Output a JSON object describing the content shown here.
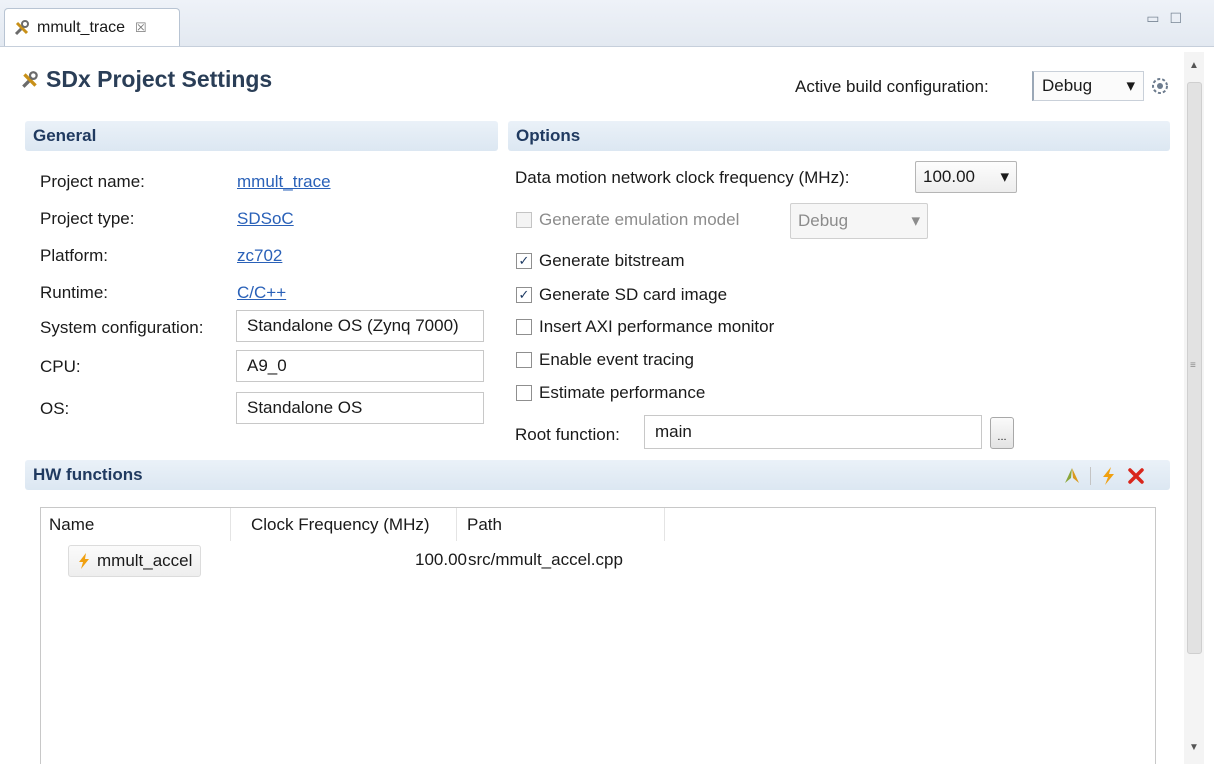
{
  "tab": {
    "label": "mmult_trace",
    "close_glyph": "☒"
  },
  "window_controls": {
    "minimize": "▭",
    "maximize": "☐"
  },
  "header": {
    "title": "SDx Project Settings",
    "active_build_label": "Active build configuration:",
    "active_build_value": "Debug"
  },
  "general": {
    "heading": "General",
    "project_name_label": "Project name:",
    "project_name_value": "mmult_trace",
    "project_type_label": "Project type:",
    "project_type_value": "SDSoC",
    "platform_label": "Platform:",
    "platform_value": "zc702",
    "runtime_label": "Runtime:",
    "runtime_value": "C/C++",
    "system_config_label": "System configuration:",
    "system_config_value": "Standalone OS (Zynq 7000)",
    "cpu_label": "CPU:",
    "cpu_value": "A9_0",
    "os_label": "OS:",
    "os_value": "Standalone OS"
  },
  "options": {
    "heading": "Options",
    "clock_label": "Data motion network clock frequency (MHz):",
    "clock_value": "100.00",
    "emulation_label": "Generate emulation model",
    "emulation_value": "Debug",
    "emulation_checked": false,
    "bitstream_label": "Generate bitstream",
    "bitstream_checked": true,
    "sdcard_label": "Generate SD card image",
    "sdcard_checked": true,
    "axi_label": "Insert AXI performance monitor",
    "axi_checked": false,
    "tracing_label": "Enable event tracing",
    "tracing_checked": false,
    "estimate_label": "Estimate performance",
    "estimate_checked": false,
    "root_label": "Root function:",
    "root_value": "main",
    "browse_label": "..."
  },
  "hw_functions": {
    "heading": "HW functions",
    "columns": [
      "Name",
      "Clock Frequency (MHz)",
      "Path"
    ],
    "rows": [
      {
        "name": "mmult_accel",
        "clock": "100.00",
        "path": "src/mmult_accel.cpp"
      }
    ]
  },
  "colors": {
    "link": "#2a61b8",
    "section_header": "#dce7f2",
    "title": "#2a3e57",
    "delete_red": "#d9261c",
    "flash_orange": "#f0a010"
  }
}
